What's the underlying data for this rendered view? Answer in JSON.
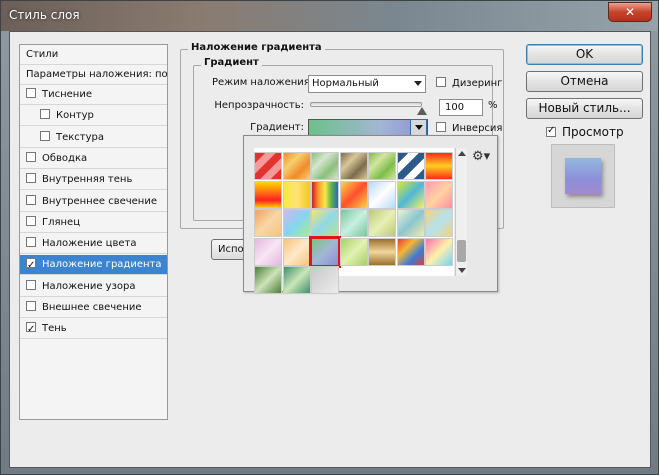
{
  "window": {
    "title": "Стиль слоя",
    "close_label": "✕"
  },
  "style_list": {
    "header_styles": "Стили",
    "header_blending": "Параметры наложения: по умолчанию",
    "items": [
      {
        "label": "Тиснение",
        "checked": false,
        "indent": false
      },
      {
        "label": "Контур",
        "checked": false,
        "indent": true
      },
      {
        "label": "Текстура",
        "checked": false,
        "indent": true
      },
      {
        "label": "Обводка",
        "checked": false,
        "indent": false
      },
      {
        "label": "Внутренняя тень",
        "checked": false,
        "indent": false
      },
      {
        "label": "Внутреннее свечение",
        "checked": false,
        "indent": false
      },
      {
        "label": "Глянец",
        "checked": false,
        "indent": false
      },
      {
        "label": "Наложение цвета",
        "checked": false,
        "indent": false
      },
      {
        "label": "Наложение градиента",
        "checked": true,
        "indent": false,
        "selected": true
      },
      {
        "label": "Наложение узора",
        "checked": false,
        "indent": false
      },
      {
        "label": "Внешнее свечение",
        "checked": false,
        "indent": false
      },
      {
        "label": "Тень",
        "checked": true,
        "indent": false
      }
    ]
  },
  "panel": {
    "group_title": "Наложение градиента",
    "subgroup_title": "Градиент",
    "blend_mode_label": "Режим наложения:",
    "blend_mode_value": "Нормальный",
    "dither_label": "Дизеринг",
    "opacity_label": "Непрозрачность:",
    "opacity_value": "100",
    "opacity_unit": "%",
    "opacity_fraction": 1.0,
    "gradient_label": "Градиент:",
    "reverse_label": "Инверсия",
    "truncated_button_label": "Испо"
  },
  "gradient_picker": {
    "gear_icon": "⚙▾",
    "selected_index": 23,
    "swatches": [
      "linear-gradient(135deg,#e3332e 0 20%,#f59a9a 20% 40%,#e3332e 40% 60%,#f59a9a 60% 80%,#e3332e 80%)",
      "linear-gradient(135deg,#f18a2a,#f6d06e,#f18a2a,#f6d06e)",
      "linear-gradient(135deg,#8bbf7c,#d6e5cf,#8bbf7c,#d6e5cf)",
      "linear-gradient(135deg,#7c6d4b,#d6c79b,#7c6d4b,#d6c79b)",
      "linear-gradient(135deg,#7ebd4a,#d2e69f,#7ebd4a,#d2e69f)",
      "linear-gradient(135deg,#2e5a8b 0 20%,#fff 20% 40%,#2e5a8b 40% 60%,#fff 60% 80%,#2e5a8b 80%)",
      "linear-gradient(180deg,#ff2a1c,#ffcf1f 50%,#ff2a1c)",
      "linear-gradient(180deg,#ffd800,#ff2020 70%,#ffd800)",
      "linear-gradient(90deg,#f6ea3a,#ffe27a 50%,#f3c71a)",
      "linear-gradient(90deg,#c62328,#ff9a2c,#ffe84b,#59b24d,#2b66c1)",
      "linear-gradient(135deg,#ffd34d,#ff4f2b,#ffd34d)",
      "linear-gradient(135deg,#b7d9f5,#ffffff,#b7d9f5)",
      "linear-gradient(135deg,#d5e93a,#4eb7d8,#f8f35a)",
      "linear-gradient(135deg,#ff99b5,#ffd3a0,#ff8ea8)",
      "linear-gradient(135deg,#f1a25c,#f8d7a4,#f5c28a)",
      "linear-gradient(135deg,#d0b8e8,#86d4f0,#a3f08c)",
      "linear-gradient(135deg,#f7e56a,#8fd8ea,#b7e48b)",
      "linear-gradient(135deg,#7ac5a0,#c8f0e0,#7ac5a0)",
      "linear-gradient(135deg,#b9c97a,#e8f0b5,#b9c97a)",
      "linear-gradient(135deg,#e9f3d0,#8ac6d0,#f5e9a8)",
      "linear-gradient(135deg,#f4d37b,#b5e2ef,#f4d37b)",
      "linear-gradient(135deg,#e6b7e0,#f7e6f3,#e6b7e0)",
      "linear-gradient(135deg,#f5c27a,#ffe9c9,#f5c27a)",
      "linear-gradient(135deg,#78c57f,#a3b6d4,#8b8ed6)",
      "linear-gradient(135deg,#a7cf69,#e3f2b2,#a7cf69)",
      "linear-gradient(180deg,#9a6f2b,#f1d79c,#9a6f2b)",
      "linear-gradient(135deg,#e53b3b,#f7b733,#3a7bd5,#e53b3b)",
      "linear-gradient(135deg,#ff6fb5,#fff1a8,#6fd3ff)",
      "linear-gradient(135deg,#4c7f3b,#cde2b8,#4c7f3b)",
      "linear-gradient(135deg,#3f8f6a,#c9e7b8,#3f8f6a)",
      "linear-gradient(135deg,#c9c9c9,#ececec)"
    ]
  },
  "buttons": {
    "ok": "OK",
    "cancel": "Отмена",
    "new_style": "Новый стиль...",
    "preview_label": "Просмотр",
    "preview_checked": true
  }
}
